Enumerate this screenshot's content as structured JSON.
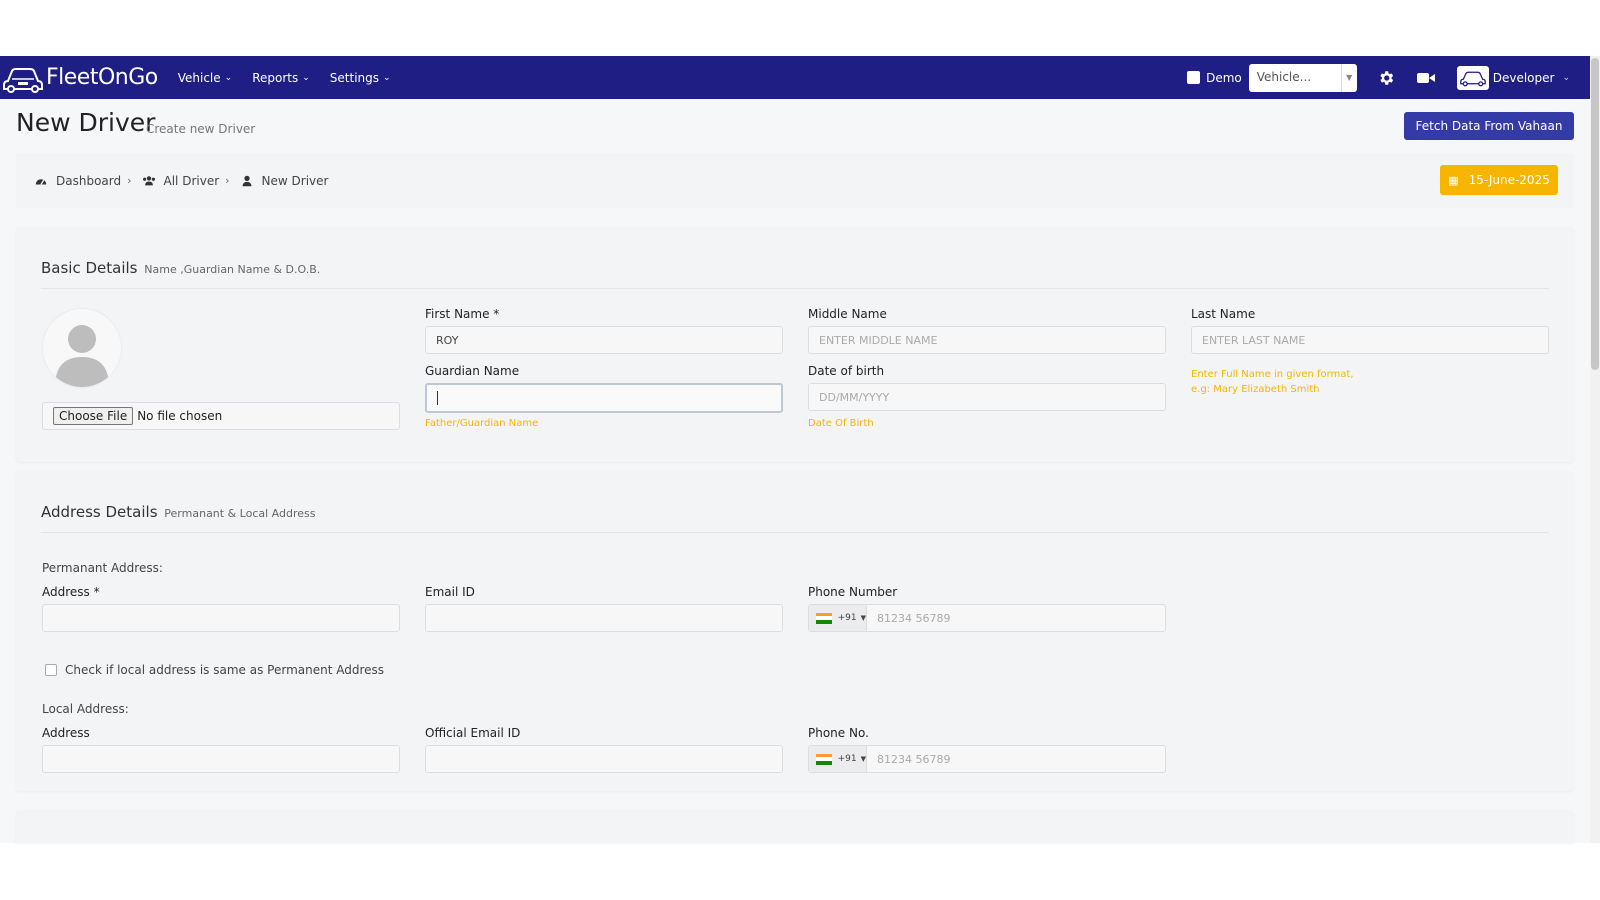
{
  "app": {
    "brand": "FleetOnGo",
    "menu": [
      {
        "label": "Vehicle"
      },
      {
        "label": "Reports"
      },
      {
        "label": "Settings"
      }
    ],
    "demo_label": "Demo",
    "vehicle_select_value": "Vehicle...",
    "user_label": "Developer"
  },
  "page": {
    "title": "New Driver",
    "subtitle": "Create new Driver",
    "fetch_button": "Fetch Data From Vahaan",
    "date": "15-June-2025"
  },
  "breadcrumb": {
    "items": [
      {
        "label": "Dashboard"
      },
      {
        "label": "All Driver"
      },
      {
        "label": "New Driver"
      }
    ]
  },
  "basic": {
    "title": "Basic Details",
    "subtitle": "Name ,Guardian Name & D.O.B.",
    "file_button": "Choose File",
    "file_text": "No file chosen",
    "first_name_label": "First Name *",
    "first_name_value": "ROY",
    "middle_name_label": "Middle Name",
    "middle_name_placeholder": "ENTER MIDDLE NAME",
    "last_name_label": "Last Name",
    "last_name_placeholder": "ENTER LAST NAME",
    "guardian_label": "Guardian Name",
    "guardian_hint": "Father/Guardian Name",
    "dob_label": "Date of birth",
    "dob_placeholder": "DD/MM/YYYY",
    "dob_hint": "Date Of Birth",
    "name_hint_1": "Enter Full Name in given format,",
    "name_hint_2": "e.g: Mary Elizabeth Smith"
  },
  "address": {
    "title": "Address Details",
    "subtitle": "Permanant & Local Address",
    "permanent_label": "Permanant Address:",
    "address_label": "Address *",
    "email_label": "Email ID",
    "phone_label": "Phone Number",
    "phone_code": "+91",
    "phone_placeholder": "81234 56789",
    "same_check_label": "Check if local address is same as Permanent Address",
    "local_label": "Local Address:",
    "local_address_label": "Address",
    "official_email_label": "Official Email ID",
    "local_phone_label": "Phone No.",
    "local_phone_code": "+91",
    "local_phone_placeholder": "81234 56789"
  },
  "colors": {
    "navbar": "#1e1e85",
    "primary_button": "#343aa6",
    "accent": "#f7b500"
  }
}
